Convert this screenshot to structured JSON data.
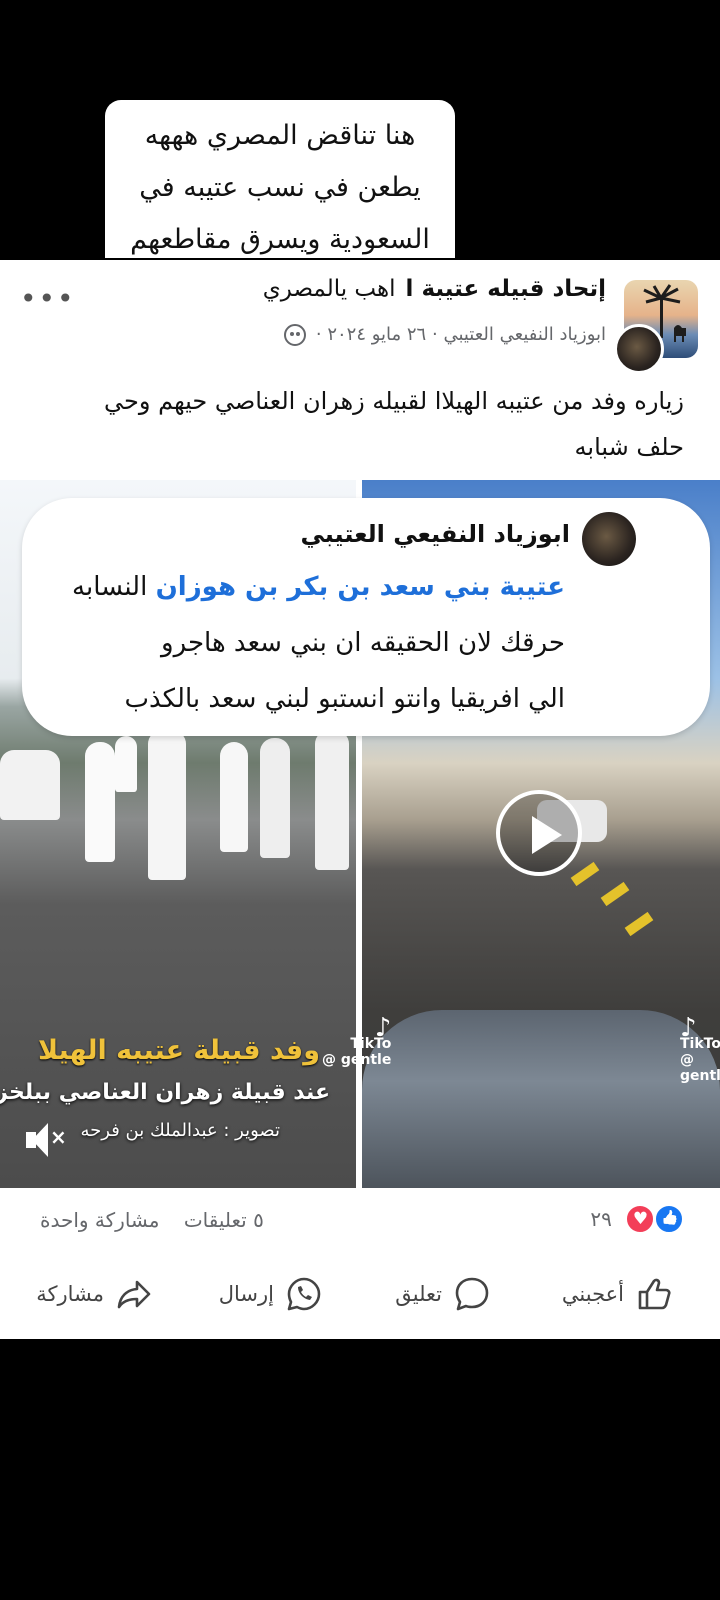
{
  "caption": {
    "lines": [
      "هنا تناقض المصري هههه",
      "يطعن في نسب عتيبه في",
      "السعودية ويسرق مقاطعهم"
    ]
  },
  "post": {
    "group_name": "إتحاد قبيله عتيبة ا",
    "group_suffix": "اهب يالمصري",
    "author": "ابوزياد النفيعي العتيبي",
    "separator": "·",
    "date": "٢٦ مايو ٢٠٢٤",
    "text": "زياره وفد من عتيبه الهيلاا لقبيله زهران العناصي حيهم وحي حلف شبابه",
    "more_icon": "•••"
  },
  "quote": {
    "author": "ابوزياد النفيعي العتيبي",
    "line1_blue": "عتيبة بني سعد بن بكر بن هوزان",
    "line1_rest": "النسابه",
    "line2": "حرقك لان الحقيقه ان بني سعد هاجرو",
    "line3": "الي افريقيا وانتو انستبو لبني سعد بالكذب"
  },
  "video_left": {
    "title": "وفد قبيلة عتيبه الهيلا",
    "subtitle": "عند قبيلة زهران العناصي ببلخزمر",
    "credit": "تصوير : عبدالملك بن فرحه",
    "mute": "×",
    "tiktok_brand": "TikTo",
    "tiktok_handle": "@ gentle"
  },
  "video_right": {
    "tiktok_brand": "TikTo",
    "tiktok_handle": "@ gentl"
  },
  "stats": {
    "reaction_count": "٢٩",
    "comments": "٥ تعليقات",
    "shares": "مشاركة واحدة"
  },
  "actions": {
    "like": "أعجبني",
    "comment": "تعليق",
    "send": "إرسال",
    "share": "مشاركة"
  },
  "colors": {
    "link_blue": "#1e6fd9",
    "facebook_blue": "#1877f2",
    "love_red": "#f33e58",
    "meta_gray": "#65676b"
  }
}
